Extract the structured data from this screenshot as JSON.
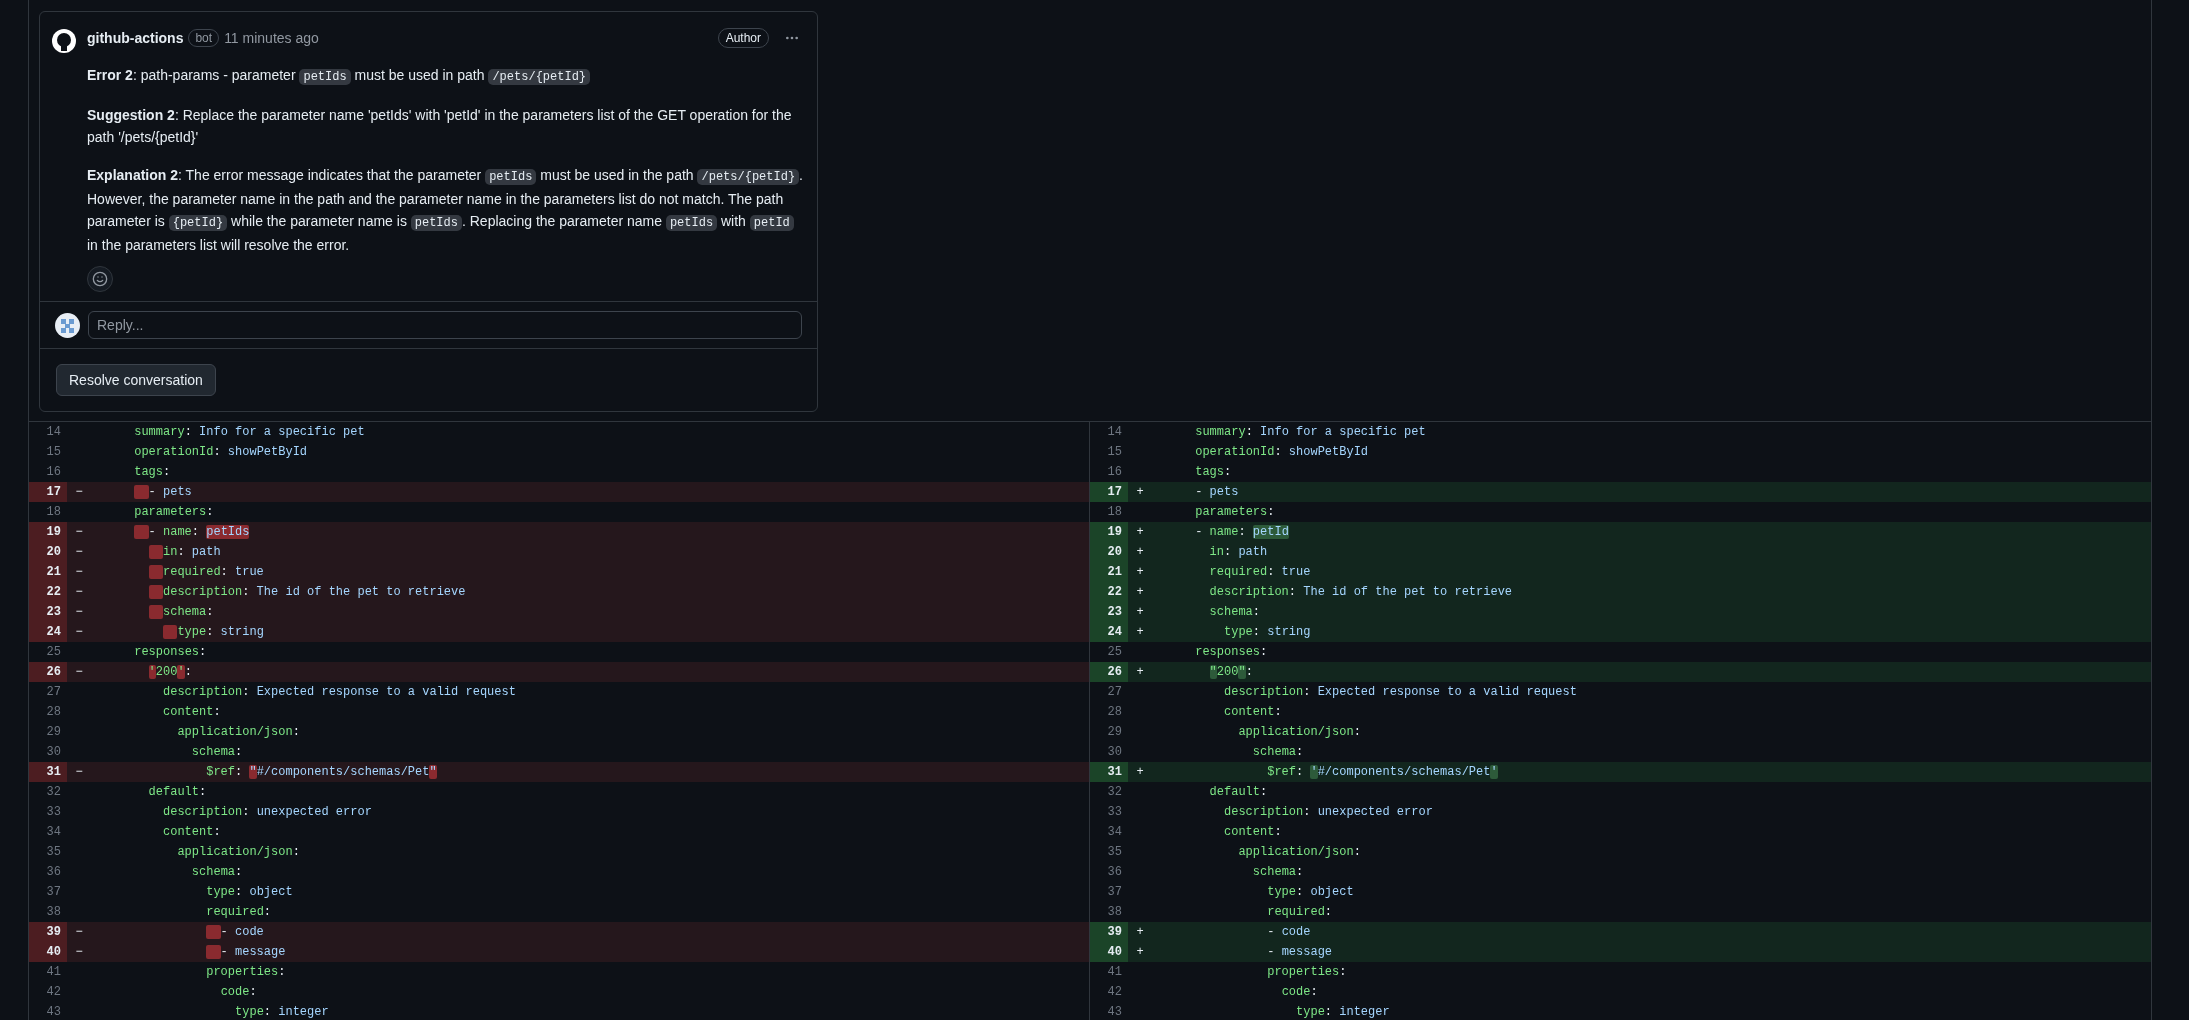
{
  "comment": {
    "author": "github-actions",
    "badge": "bot",
    "time": "11 minutes ago",
    "role": "Author",
    "paragraphs": [
      [
        {
          "text": "**Error 2**: path-params - parameter "
        },
        {
          "text": "petIds",
          "kind": "code"
        },
        {
          "text": " must be used in path "
        },
        {
          "text": "/pets/{petId}",
          "kind": "code"
        }
      ],
      [
        {
          "text": "**Suggestion 2**: Replace the parameter name 'petIds' with 'petId' in the parameters list of the GET operation for the path '/pets/{petId}'"
        }
      ],
      [
        {
          "text": "**Explanation 2**: The error message indicates that the parameter "
        },
        {
          "text": "petIds",
          "kind": "code"
        },
        {
          "text": " must be used in the path "
        },
        {
          "text": "/pets/{petId}",
          "kind": "code"
        },
        {
          "text": ". However, the parameter name in the path and the parameter name in the parameters list do not match. The path parameter is "
        },
        {
          "text": "{petId}",
          "kind": "code"
        },
        {
          "text": " while the parameter name is "
        },
        {
          "text": "petIds",
          "kind": "code"
        },
        {
          "text": ". Replacing the parameter name "
        },
        {
          "text": "petIds",
          "kind": "code"
        },
        {
          "text": " with "
        },
        {
          "text": "petId",
          "kind": "code"
        },
        {
          "text": " in the parameters list will resolve the error."
        }
      ]
    ],
    "reply": {
      "placeholder": "Reply..."
    },
    "resolve_button": "Resolve conversation"
  },
  "diff": {
    "left": [
      {
        "number": "14",
        "kind": "context",
        "code": "      summary: Info for a specific pet"
      },
      {
        "number": "15",
        "kind": "context",
        "code": "      operationId: showPetById"
      },
      {
        "number": "16",
        "kind": "context",
        "code": "      tags:"
      },
      {
        "number": "17",
        "kind": "deleted",
        "sign": "−",
        "removed_indent": true,
        "code": "      - pets"
      },
      {
        "number": "18",
        "kind": "context",
        "code": "      parameters:"
      },
      {
        "number": "19",
        "kind": "deleted",
        "sign": "−",
        "removed_indent": true,
        "segments": [
          {
            "text": "      - name: "
          },
          {
            "text": "petIds",
            "changed": true
          }
        ]
      },
      {
        "number": "20",
        "kind": "deleted",
        "sign": "−",
        "removed_indent": true,
        "code": "        in: path"
      },
      {
        "number": "21",
        "kind": "deleted",
        "sign": "−",
        "removed_indent": true,
        "code": "        required: true"
      },
      {
        "number": "22",
        "kind": "deleted",
        "sign": "−",
        "removed_indent": true,
        "code": "        description: The id of the pet to retrieve"
      },
      {
        "number": "23",
        "kind": "deleted",
        "sign": "−",
        "removed_indent": true,
        "code": "        schema:"
      },
      {
        "number": "24",
        "kind": "deleted",
        "sign": "−",
        "removed_indent": true,
        "code": "          type: string"
      },
      {
        "number": "25",
        "kind": "context",
        "code": "      responses:"
      },
      {
        "number": "26",
        "kind": "deleted",
        "sign": "−",
        "removed_indent": false,
        "segments": [
          {
            "text": "        '",
            "changed": true
          },
          {
            "text": "200"
          },
          {
            "text": "'",
            "changed": true
          },
          {
            "text": ":"
          }
        ]
      },
      {
        "number": "27",
        "kind": "context",
        "code": "          description: Expected response to a valid request"
      },
      {
        "number": "28",
        "kind": "context",
        "code": "          content:"
      },
      {
        "number": "29",
        "kind": "context",
        "code": "            application/json:"
      },
      {
        "number": "30",
        "kind": "context",
        "code": "              schema:"
      },
      {
        "number": "31",
        "kind": "deleted",
        "sign": "−",
        "removed_indent": false,
        "segments": [
          {
            "text": "                $ref: "
          },
          {
            "text": "\"",
            "changed": true
          },
          {
            "text": "#/components/schemas/Pet"
          },
          {
            "text": "\"",
            "changed": true
          }
        ]
      },
      {
        "number": "32",
        "kind": "context",
        "code": "        default:"
      },
      {
        "number": "33",
        "kind": "context",
        "code": "          description: unexpected error"
      },
      {
        "number": "34",
        "kind": "context",
        "code": "          content:"
      },
      {
        "number": "35",
        "kind": "context",
        "code": "            application/json:"
      },
      {
        "number": "36",
        "kind": "context",
        "code": "              schema:"
      },
      {
        "number": "37",
        "kind": "context",
        "code": "                type: object"
      },
      {
        "number": "38",
        "kind": "context",
        "code": "                required:"
      },
      {
        "number": "39",
        "kind": "deleted",
        "sign": "−",
        "removed_indent": true,
        "code": "                - code"
      },
      {
        "number": "40",
        "kind": "deleted",
        "sign": "−",
        "removed_indent": true,
        "code": "                - message"
      },
      {
        "number": "41",
        "kind": "context",
        "code": "                properties:"
      },
      {
        "number": "42",
        "kind": "context",
        "code": "                  code:"
      },
      {
        "number": "43",
        "kind": "context",
        "code": "                    type: integer"
      }
    ],
    "right": [
      {
        "number": "14",
        "kind": "context",
        "code": "      summary: Info for a specific pet"
      },
      {
        "number": "15",
        "kind": "context",
        "code": "      operationId: showPetById"
      },
      {
        "number": "16",
        "kind": "context",
        "code": "      tags:"
      },
      {
        "number": "17",
        "kind": "added",
        "sign": "+",
        "code": "      - pets"
      },
      {
        "number": "18",
        "kind": "context",
        "code": "      parameters:"
      },
      {
        "number": "19",
        "kind": "added",
        "sign": "+",
        "segments": [
          {
            "text": "      - name: "
          },
          {
            "text": "petId",
            "changed": true
          }
        ]
      },
      {
        "number": "20",
        "kind": "added",
        "sign": "+",
        "code": "        in: path"
      },
      {
        "number": "21",
        "kind": "added",
        "sign": "+",
        "code": "        required: true"
      },
      {
        "number": "22",
        "kind": "added",
        "sign": "+",
        "code": "        description: The id of the pet to retrieve"
      },
      {
        "number": "23",
        "kind": "added",
        "sign": "+",
        "code": "        schema:"
      },
      {
        "number": "24",
        "kind": "added",
        "sign": "+",
        "code": "          type: string"
      },
      {
        "number": "25",
        "kind": "context",
        "code": "      responses:"
      },
      {
        "number": "26",
        "kind": "added",
        "sign": "+",
        "segments": [
          {
            "text": "        \"",
            "changed": true
          },
          {
            "text": "200"
          },
          {
            "text": "\"",
            "changed": true
          },
          {
            "text": ":"
          }
        ]
      },
      {
        "number": "27",
        "kind": "context",
        "code": "          description: Expected response to a valid request"
      },
      {
        "number": "28",
        "kind": "context",
        "code": "          content:"
      },
      {
        "number": "29",
        "kind": "context",
        "code": "            application/json:"
      },
      {
        "number": "30",
        "kind": "context",
        "code": "              schema:"
      },
      {
        "number": "31",
        "kind": "added",
        "sign": "+",
        "segments": [
          {
            "text": "                $ref: "
          },
          {
            "text": "'",
            "changed": true
          },
          {
            "text": "#/components/schemas/Pet"
          },
          {
            "text": "'",
            "changed": true
          }
        ]
      },
      {
        "number": "32",
        "kind": "context",
        "code": "        default:"
      },
      {
        "number": "33",
        "kind": "context",
        "code": "          description: unexpected error"
      },
      {
        "number": "34",
        "kind": "context",
        "code": "          content:"
      },
      {
        "number": "35",
        "kind": "context",
        "code": "            application/json:"
      },
      {
        "number": "36",
        "kind": "context",
        "code": "              schema:"
      },
      {
        "number": "37",
        "kind": "context",
        "code": "                type: object"
      },
      {
        "number": "38",
        "kind": "context",
        "code": "                required:"
      },
      {
        "number": "39",
        "kind": "added",
        "sign": "+",
        "code": "                - code"
      },
      {
        "number": "40",
        "kind": "added",
        "sign": "+",
        "code": "                - message"
      },
      {
        "number": "41",
        "kind": "context",
        "code": "                properties:"
      },
      {
        "number": "42",
        "kind": "context",
        "code": "                  code:"
      },
      {
        "number": "43",
        "kind": "context",
        "code": "                    type: integer"
      }
    ]
  }
}
